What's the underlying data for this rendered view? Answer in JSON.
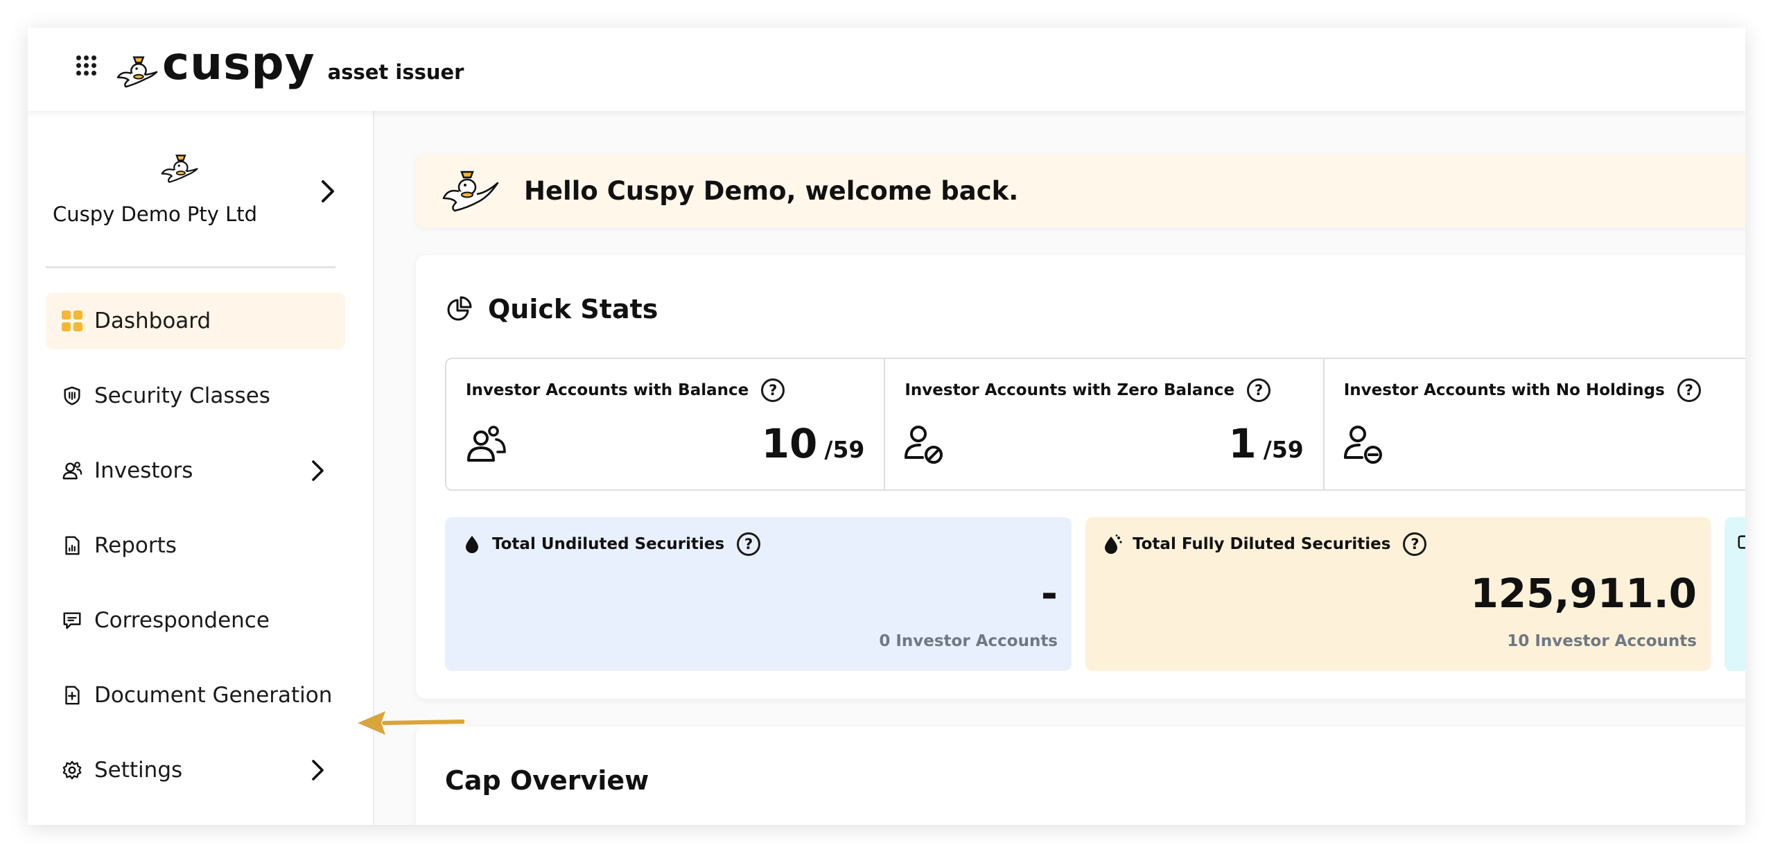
{
  "header": {
    "brand": "cuspy",
    "subtitle": "asset issuer",
    "apps_icon": "grid-dots-icon",
    "logo_icon": "cuspy-bird-logo"
  },
  "sidebar": {
    "org_name": "Cuspy Demo Pty Ltd",
    "items": [
      {
        "label": "Dashboard",
        "icon": "dashboard-grid-icon",
        "active": true,
        "has_submenu": false
      },
      {
        "label": "Security Classes",
        "icon": "shield-icon",
        "active": false,
        "has_submenu": false
      },
      {
        "label": "Investors",
        "icon": "user-group-icon",
        "active": false,
        "has_submenu": true
      },
      {
        "label": "Reports",
        "icon": "report-file-icon",
        "active": false,
        "has_submenu": false
      },
      {
        "label": "Correspondence",
        "icon": "message-icon",
        "active": false,
        "has_submenu": false
      },
      {
        "label": "Document Generation",
        "icon": "file-plus-icon",
        "active": false,
        "has_submenu": false
      },
      {
        "label": "Settings",
        "icon": "gear-icon",
        "active": false,
        "has_submenu": true
      }
    ]
  },
  "welcome": {
    "text": "Hello Cuspy Demo, welcome back."
  },
  "quick_stats": {
    "title": "Quick Stats",
    "accounts": [
      {
        "label": "Investor Accounts with Balance",
        "value": "10",
        "total": "/59",
        "icon": "users-icon"
      },
      {
        "label": "Investor Accounts with Zero Balance",
        "value": "1",
        "total": "/59",
        "icon": "user-blocked-icon"
      },
      {
        "label": "Investor Accounts with No Holdings",
        "value": "",
        "total": "",
        "icon": "user-minus-icon"
      }
    ],
    "securities": [
      {
        "label": "Total Undiluted Securities",
        "value": "-",
        "sub": "0 Investor Accounts",
        "icon": "drop-icon"
      },
      {
        "label": "Total Fully Diluted Securities",
        "value": "125,911.0",
        "sub": "10 Investor Accounts",
        "icon": "diluted-drop-icon"
      }
    ]
  },
  "cap_overview": {
    "title": "Cap Overview"
  },
  "colors": {
    "accent": "#f5b731",
    "active_nav_bg": "#fff6e9",
    "welcome_bg": "#fff7ea",
    "undiluted_bg": "#e9f0fd",
    "diluted_bg": "#fdf1d9",
    "third_card_bg": "#ddf8fb",
    "arrow": "#d9a43a",
    "muted_text": "#6f7883"
  }
}
